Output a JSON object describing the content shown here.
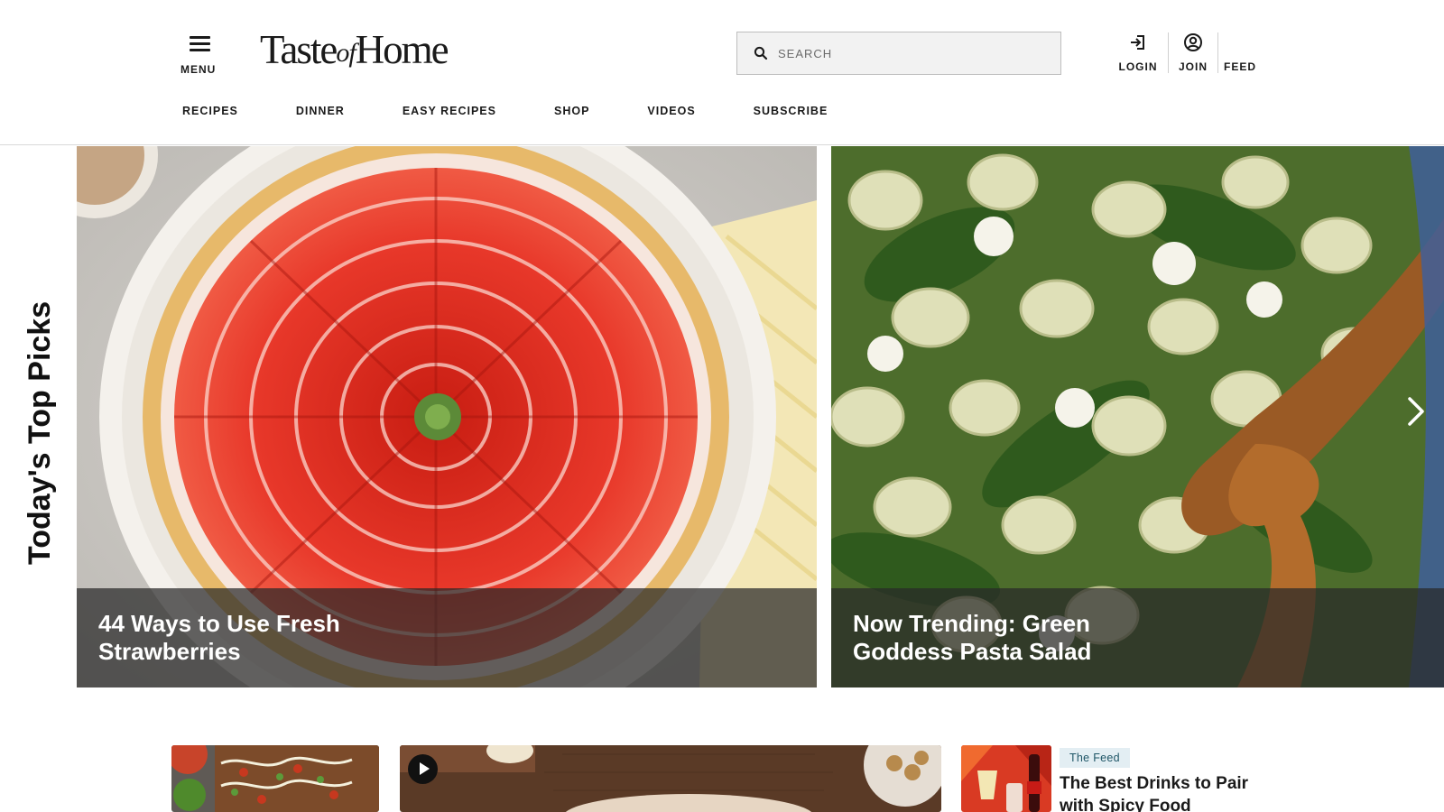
{
  "header": {
    "menu_label": "MENU",
    "logo": {
      "taste": "Taste",
      "of": "of",
      "home": "Home"
    },
    "search_placeholder": "SEARCH",
    "account": {
      "login_label": "LOGIN",
      "join_label": "JOIN",
      "feed_label": "FEED"
    },
    "nav": [
      "RECIPES",
      "DINNER",
      "EASY RECIPES",
      "SHOP",
      "VIDEOS",
      "SUBSCRIBE"
    ]
  },
  "top_picks": {
    "title": "Today's Top Picks",
    "cards": [
      {
        "title": "44 Ways to Use Fresh Strawberries"
      },
      {
        "title": "Now Trending: Green Goddess Pasta Salad"
      }
    ]
  },
  "feed_card": {
    "badge": "The Feed",
    "title": "The Best Drinks to Pair with Spicy Food"
  },
  "icons": {
    "menu": "hamburger-icon",
    "search": "search-icon",
    "login": "login-arrow-icon",
    "join": "user-circle-icon",
    "next": "chevron-right-icon",
    "play": "play-icon"
  },
  "colors": {
    "text": "#1a1a1a",
    "caption_overlay": "#282828",
    "feed_badge_bg": "#e3eef3",
    "feed_badge_text": "#1e5566"
  }
}
